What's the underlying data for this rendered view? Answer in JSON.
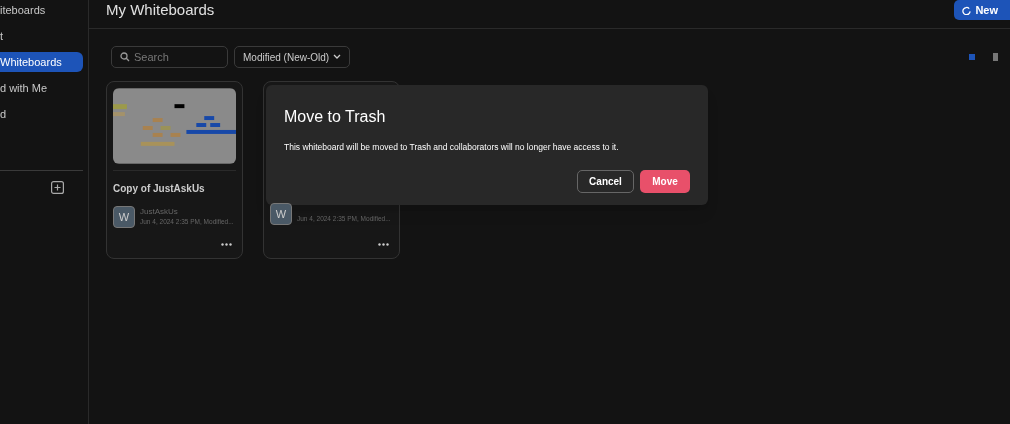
{
  "sidebar": {
    "items": [
      {
        "label": "iteboards",
        "selected": false
      },
      {
        "label": "t",
        "selected": false
      },
      {
        "label": "Whiteboards",
        "selected": true
      },
      {
        "label": "d with Me",
        "selected": false
      },
      {
        "label": "d",
        "selected": false
      }
    ]
  },
  "header": {
    "title": "My Whiteboards",
    "new_button": "New"
  },
  "toolbar": {
    "search": {
      "placeholder": "Search"
    },
    "sort": "Modified (New-Old)",
    "views": [
      {
        "kind": "grid",
        "selected": true
      },
      {
        "kind": "list",
        "selected": false
      }
    ]
  },
  "cards": [
    {
      "title": "Copy of JustAskUs",
      "avatar": "W",
      "owner": "JustAskUs",
      "date": "Jun 4, 2024 2:35 PM, Modified...",
      "thumbnail": true
    },
    {
      "avatar": "W",
      "date": "Jun 4, 2024 2:35 PM, Modified...",
      "thumbnail": false
    }
  ],
  "dialog": {
    "title": "Move to Trash",
    "message": "This whiteboard will be moved to Trash and collaborators will no longer have access to it.",
    "buttons": [
      {
        "label": "Cancel",
        "kind": "secondary"
      },
      {
        "label": "Move",
        "kind": "primary"
      }
    ]
  }
}
